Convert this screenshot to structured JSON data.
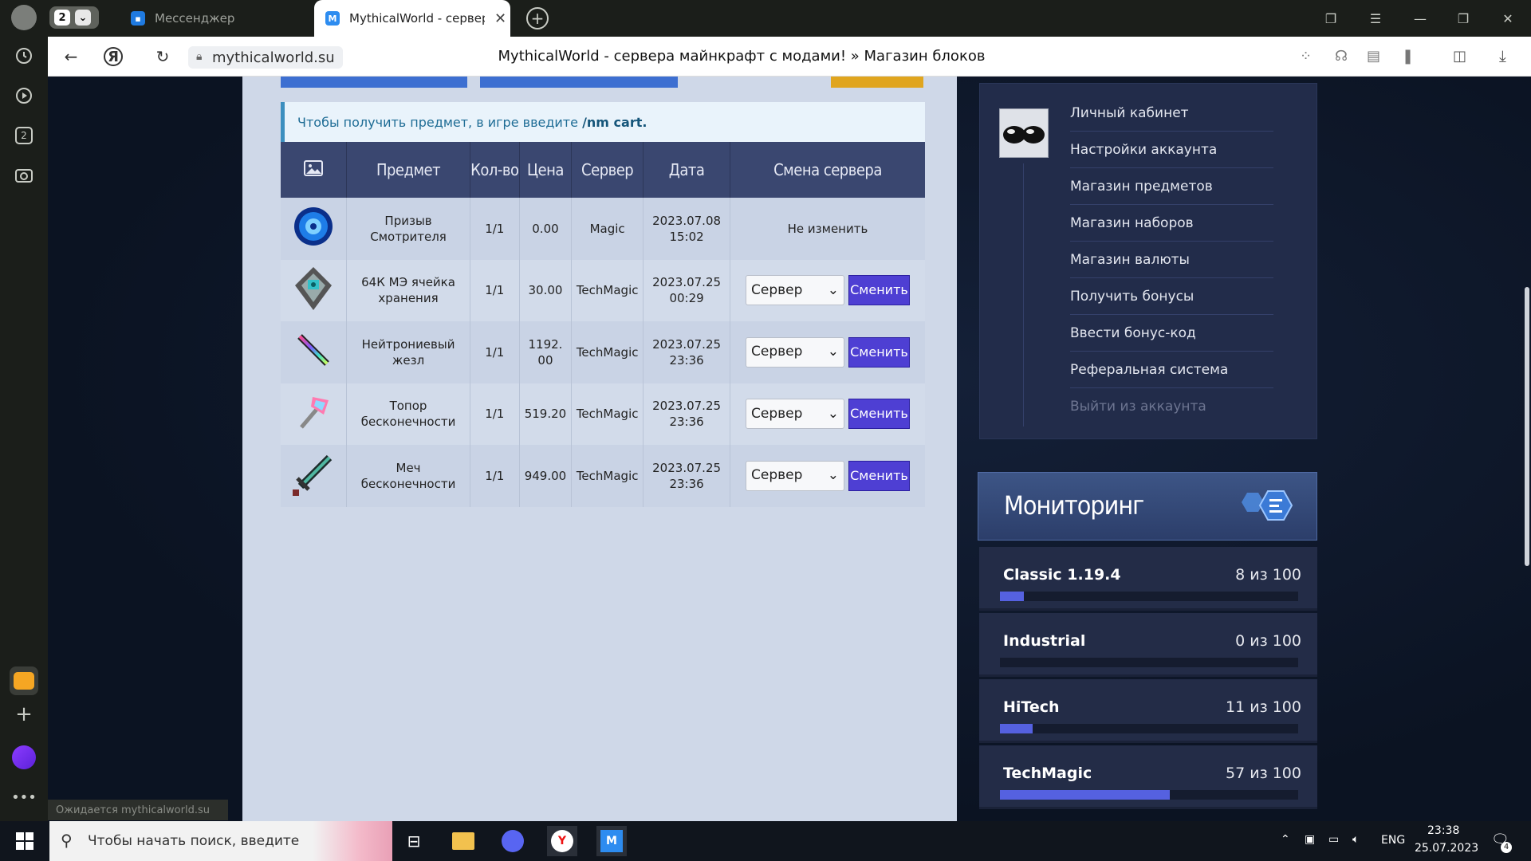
{
  "browser": {
    "tab_count": "2",
    "tabs": [
      {
        "label": "Мессенджер"
      },
      {
        "label": "MythicalWorld - сервер"
      }
    ],
    "url": "mythicalworld.su",
    "page_title": "MythicalWorld - сервера майнкрафт с модами! » Магазин блоков",
    "status": "Ожидается mythicalworld.su",
    "rail_badge": "2"
  },
  "notice": {
    "text": "Чтобы получить предмет, в игре введите ",
    "command": "/nm cart."
  },
  "table": {
    "headers": [
      "Предмет",
      "Кол-во",
      "Цена",
      "Сервер",
      "Дата",
      "Смена сервера"
    ],
    "rows": [
      {
        "name": "Призыв Смотрителя",
        "qty": "1/1",
        "price": "0.00",
        "server": "Magic",
        "date": "2023.07.08",
        "time": "15:02",
        "change": "Не изменить"
      },
      {
        "name": "64К МЭ ячейка хранения",
        "qty": "1/1",
        "price": "30.00",
        "server": "TechMagic",
        "date": "2023.07.25",
        "time": "00:29",
        "select": "Сервер",
        "button": "Сменить"
      },
      {
        "name": "Нейтрониевый жезл",
        "qty": "1/1",
        "price": "1192.00",
        "server": "TechMagic",
        "date": "2023.07.25",
        "time": "23:36",
        "select": "Сервер",
        "button": "Сменить"
      },
      {
        "name": "Топор бесконечности",
        "qty": "1/1",
        "price": "519.20",
        "server": "TechMagic",
        "date": "2023.07.25",
        "time": "23:36",
        "select": "Сервер",
        "button": "Сменить"
      },
      {
        "name": "Меч бесконечности",
        "qty": "1/1",
        "price": "949.00",
        "server": "TechMagic",
        "date": "2023.07.25",
        "time": "23:36",
        "select": "Сервер",
        "button": "Сменить"
      }
    ]
  },
  "menu": {
    "items": [
      "Личный кабинет",
      "Настройки аккаунта",
      "Магазин предметов",
      "Магазин наборов",
      "Магазин валюты",
      "Получить бонусы",
      "Ввести бонус-код",
      "Реферальная система",
      "Выйти из аккаунта"
    ]
  },
  "monitoring": {
    "title": "Мониторинг",
    "servers": [
      {
        "name": "Classic 1.19.4",
        "count": "8 из 100",
        "fill": 0.08
      },
      {
        "name": "Industrial",
        "count": "0 из 100",
        "fill": 0.0
      },
      {
        "name": "HiTech",
        "count": "11 из 100",
        "fill": 0.11
      },
      {
        "name": "TechMagic",
        "count": "57 из 100",
        "fill": 0.57
      }
    ]
  },
  "taskbar": {
    "search_placeholder": "Чтобы начать поиск, введите",
    "lang": "ENG",
    "time": "23:38",
    "date": "25.07.2023",
    "notif": "4"
  }
}
